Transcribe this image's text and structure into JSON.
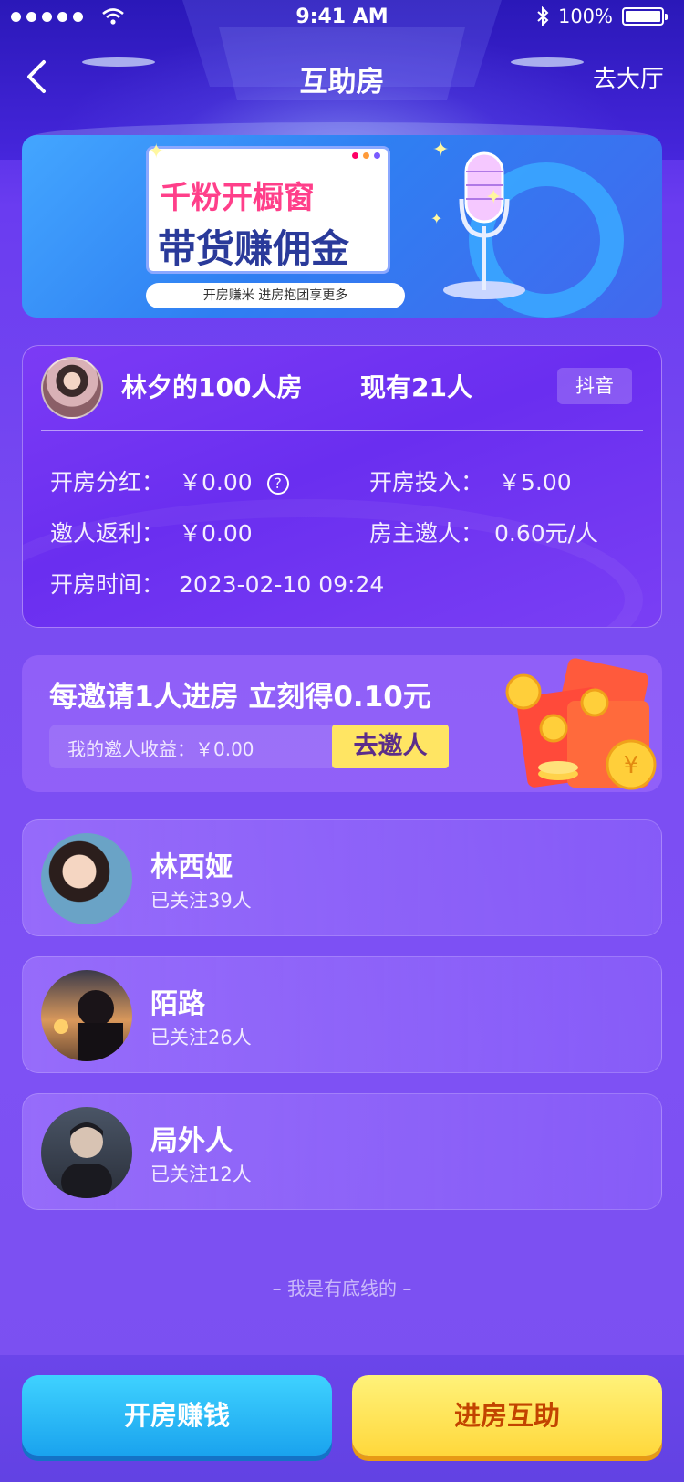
{
  "status_bar": {
    "time": "9:41 AM",
    "battery": "100%"
  },
  "nav": {
    "title": "互助房",
    "right_label": "去大厅"
  },
  "banner": {
    "line1": "千粉开橱窗",
    "line2": "带货赚佣金",
    "subtitle": "开房赚米  进房抱团享更多"
  },
  "room": {
    "name": "林夕的100人房",
    "count": "现有21人",
    "platform": "抖音",
    "dividend_label": "开房分红：",
    "dividend_value": "￥0.00",
    "investment_label": "开房投入：",
    "investment_value": "￥5.00",
    "rebate_label": "邀人返利：",
    "rebate_value": "￥0.00",
    "owner_invite_label": "房主邀人：",
    "owner_invite_value": "0.60元/人",
    "open_time_label": "开房时间：",
    "open_time_value": "2023-02-10 09:24"
  },
  "invite": {
    "title": "每邀请1人进房 立刻得0.10元",
    "income_label": "我的邀人收益：￥0.00",
    "button": "去邀人"
  },
  "members": [
    {
      "name": "林西娅",
      "followers": "已关注39人"
    },
    {
      "name": "陌路",
      "followers": "已关注26人"
    },
    {
      "name": "局外人",
      "followers": "已关注12人"
    }
  ],
  "footer_note": "– 我是有底线的 –",
  "bottom": {
    "open_room": "开房赚钱",
    "enter_room": "进房互助"
  },
  "colors": {
    "accent_yellow": "#ffe563",
    "button_blue": "#1aa3ee",
    "button_orange_text": "#c24400"
  }
}
